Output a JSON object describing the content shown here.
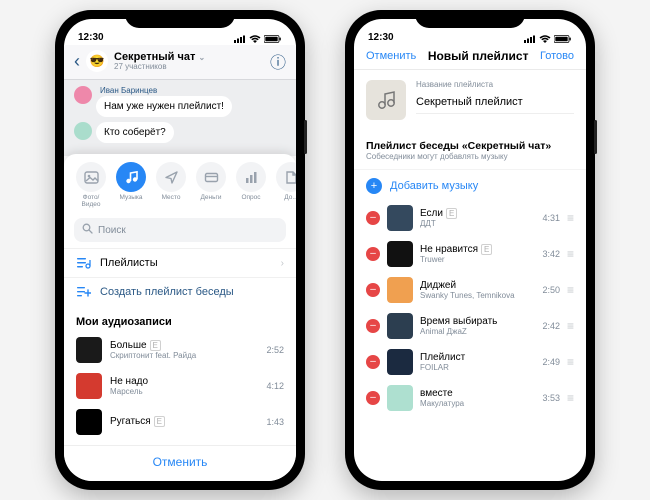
{
  "status_time": "12:30",
  "left": {
    "chat_title": "Секретный чат",
    "chat_sub": "27 участников",
    "msg_sender": "Иван Баринцев",
    "msg1": "Нам уже нужен плейлист!",
    "msg2": "Кто соберёт?",
    "attach": [
      {
        "label": "Фото/Видео",
        "icon": "image"
      },
      {
        "label": "Музыка",
        "icon": "music",
        "active": true
      },
      {
        "label": "Место",
        "icon": "location"
      },
      {
        "label": "Деньги",
        "icon": "card"
      },
      {
        "label": "Опрос",
        "icon": "poll"
      },
      {
        "label": "До...",
        "icon": "doc"
      }
    ],
    "search": "Поиск",
    "playlists_label": "Плейлисты",
    "create_label": "Создать плейлист беседы",
    "my_audio_header": "Мои аудиозаписи",
    "tracks": [
      {
        "title": "Больше",
        "explicit": true,
        "artist": "Скриптонит feat. Райда",
        "dur": "2:52",
        "cov": "#1a1a1a"
      },
      {
        "title": "Не надо",
        "explicit": false,
        "artist": "Марсель",
        "dur": "4:12",
        "cov": "#d43a2f"
      },
      {
        "title": "Ругаться",
        "explicit": true,
        "artist": "",
        "dur": "1:43",
        "cov": "#000"
      }
    ],
    "cancel": "Отменить"
  },
  "right": {
    "nav_left": "Отменить",
    "nav_title": "Новый плейлист",
    "nav_right": "Готово",
    "pl_name_label": "Название плейлиста",
    "pl_name_value": "Секретный плейлист",
    "section_title": "Плейлист беседы «Секретный чат»",
    "section_sub": "Собеседники могут добавлять музыку",
    "add_music": "Добавить музыку",
    "tracks": [
      {
        "title": "Если",
        "explicit": true,
        "artist": "ДДТ",
        "dur": "4:31",
        "cov": "#34495e"
      },
      {
        "title": "Не нравится",
        "explicit": true,
        "artist": "Truwer",
        "dur": "3:42",
        "cov": "#111"
      },
      {
        "title": "Диджей",
        "explicit": false,
        "artist": "Swanky Tunes, Temnikova",
        "dur": "2:50",
        "cov": "#f0a050"
      },
      {
        "title": "Время выбирать",
        "explicit": false,
        "artist": "Animal ДжаZ",
        "dur": "2:42",
        "cov": "#2c3e50"
      },
      {
        "title": "Плейлист",
        "explicit": false,
        "artist": "FOILAR",
        "dur": "2:49",
        "cov": "#1b2a40"
      },
      {
        "title": "вместе",
        "explicit": false,
        "artist": "Макулатура",
        "dur": "3:53",
        "cov": "#aee0d0"
      }
    ]
  }
}
